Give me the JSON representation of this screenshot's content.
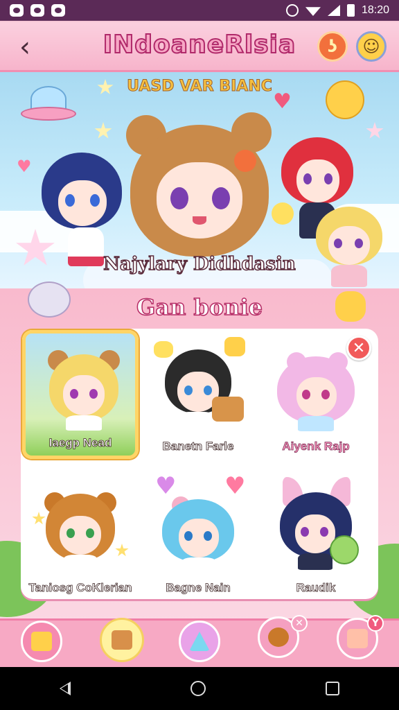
{
  "status_bar": {
    "time": "18:20"
  },
  "header": {
    "title": "INdoaneRlsia",
    "back_icon": "chevron-left-icon"
  },
  "banner": {
    "tagline": "UASD VAR BIANC",
    "featured_name": "Najylary Didhdasin"
  },
  "section": {
    "title": "Gan bonie"
  },
  "characters": [
    {
      "name": "Iaegp Nead",
      "selected": true
    },
    {
      "name": "Banetn Farle",
      "selected": false
    },
    {
      "name": "Aiyenk Rajp",
      "selected": false
    },
    {
      "name": "Taniosg CoKlerian",
      "selected": false
    },
    {
      "name": "Bagne Nain",
      "selected": false
    },
    {
      "name": "Raudik",
      "selected": false
    }
  ],
  "toolbar": {
    "items": [
      "box-icon",
      "chest-icon",
      "wand-icon",
      "pet-icon",
      "drink-icon"
    ]
  },
  "colors": {
    "accent": "#f7a9c4",
    "title_stroke": "#b0296a",
    "close": "#f15a5a"
  }
}
